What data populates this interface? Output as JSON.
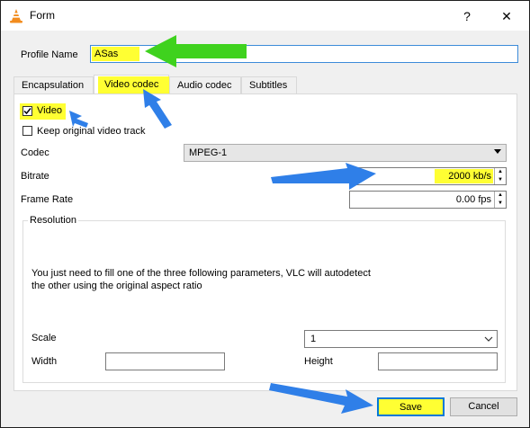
{
  "window": {
    "title": "Form",
    "help_glyph": "?",
    "close_glyph": "✕"
  },
  "profile": {
    "label": "Profile Name",
    "value": "ASas"
  },
  "tabs": [
    {
      "label": "Encapsulation"
    },
    {
      "label": "Video codec"
    },
    {
      "label": "Audio codec"
    },
    {
      "label": "Subtitles"
    }
  ],
  "video": {
    "video_label": "Video",
    "video_checked": true,
    "keep_label": "Keep original video track",
    "keep_checked": false,
    "codec_label": "Codec",
    "codec_value": "MPEG-1",
    "bitrate_label": "Bitrate",
    "bitrate_value": "2000 kb/s",
    "framerate_label": "Frame Rate",
    "framerate_value": "0.00 fps"
  },
  "resolution": {
    "group_label": "Resolution",
    "info_line1": "You just need to fill one of the three following parameters, VLC will autodetect",
    "info_line2": "the other using the original aspect ratio",
    "scale_label": "Scale",
    "scale_value": "1",
    "width_label": "Width",
    "width_value": "",
    "height_label": "Height",
    "height_value": ""
  },
  "buttons": {
    "save": "Save",
    "cancel": "Cancel"
  },
  "colors": {
    "highlight": "#ffff33",
    "blue_arrow": "#2f7fe8",
    "green_arrow": "#3fd21e"
  }
}
